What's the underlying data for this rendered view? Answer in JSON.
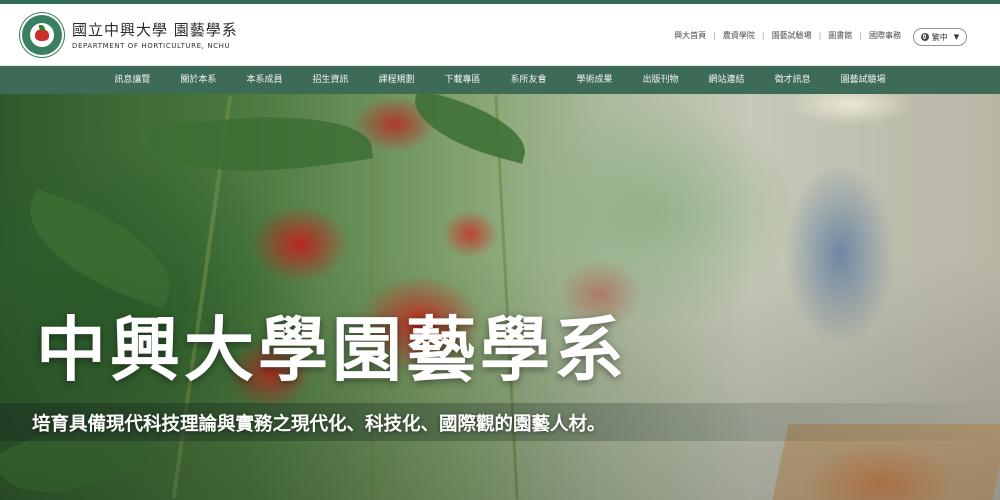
{
  "header": {
    "title_cn": "國立中興大學 園藝學系",
    "title_en": "DEPARTMENT OF HORTICULTURE, NCHU",
    "logo_icon": "nchu-seal-icon",
    "top_links": [
      "興大首頁",
      "農資學院",
      "園藝試驗場",
      "圖書館",
      "國際事務"
    ],
    "separator": "|",
    "language": {
      "label": "繁中",
      "icon": "globe-icon",
      "chevron": "▼"
    }
  },
  "nav": {
    "items": [
      "訊息讓覽",
      "關於本系",
      "本系成員",
      "招生資訊",
      "課程規劃",
      "下載專區",
      "系所友會",
      "學術成果",
      "出版刊物",
      "網站連結",
      "徵才訊息",
      "園藝試驗場"
    ]
  },
  "hero": {
    "title": "中興大學園藝學系",
    "subtitle": "培育具備現代科技理論與實務之現代化、科技化、國際觀的園藝人材。"
  },
  "colors": {
    "brand_green": "#3d6b58",
    "top_bar": "#2f6b54",
    "nav_text": "#f2f5f3"
  }
}
